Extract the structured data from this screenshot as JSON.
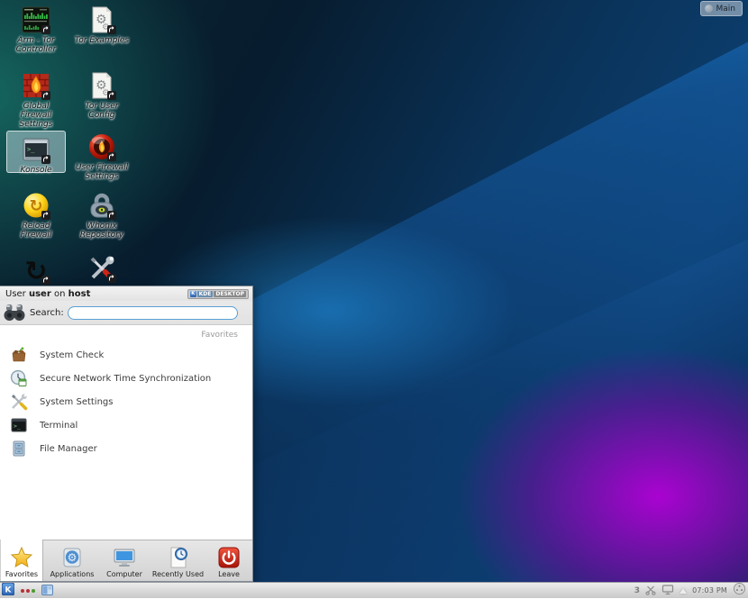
{
  "activity": {
    "label": "Main"
  },
  "desktop_icons": [
    {
      "name": "arm-tor-controller",
      "line1": "Arm - Tor",
      "line2": "Controller"
    },
    {
      "name": "tor-examples",
      "line1": "Tor Examples",
      "line2": ""
    },
    {
      "name": "global-firewall-settings",
      "line1": "Global Firewall",
      "line2": "Settings"
    },
    {
      "name": "tor-user-config",
      "line1": "Tor User",
      "line2": "Config"
    },
    {
      "name": "konsole",
      "line1": "Konsole",
      "line2": "",
      "selected": true
    },
    {
      "name": "user-firewall-settings",
      "line1": "User Firewall",
      "line2": "Settings"
    },
    {
      "name": "reload-firewall",
      "line1": "Reload",
      "line2": "Firewall"
    },
    {
      "name": "whonix-repository",
      "line1": "Whonix",
      "line2": "Repository"
    },
    {
      "name": "partial-refresh",
      "line1": "",
      "line2": ""
    },
    {
      "name": "partial-tools",
      "line1": "",
      "line2": ""
    }
  ],
  "kickoff": {
    "header": {
      "word1": "User",
      "user": "user",
      "word2": "on",
      "host": "host"
    },
    "badge": {
      "k": "K",
      "kde": "KDE",
      "desktop": "DESKTOP"
    },
    "search": {
      "label": "Search:",
      "value": "",
      "placeholder": ""
    },
    "section": "Favorites",
    "items": [
      {
        "label": "System Check"
      },
      {
        "label": "Secure Network Time Synchronization"
      },
      {
        "label": "System Settings"
      },
      {
        "label": "Terminal"
      },
      {
        "label": "File Manager"
      }
    ],
    "tabs": [
      {
        "label": "Favorites",
        "active": true
      },
      {
        "label": "Applications",
        "active": false
      },
      {
        "label": "Computer",
        "active": false
      },
      {
        "label": "Recently Used",
        "active": false
      },
      {
        "label": "Leave",
        "active": false
      }
    ]
  },
  "taskbar": {
    "clock": "07:03 PM",
    "tray_sdwdate_glyph": "3"
  },
  "colors": {
    "bright_blue": "#1a86d8",
    "purple_glow": "#a000d0",
    "teal_glow": "#18766a",
    "selection_box": "#daeef3",
    "panel_gray": "#d6d6d6",
    "search_border": "#5a9fd4"
  }
}
